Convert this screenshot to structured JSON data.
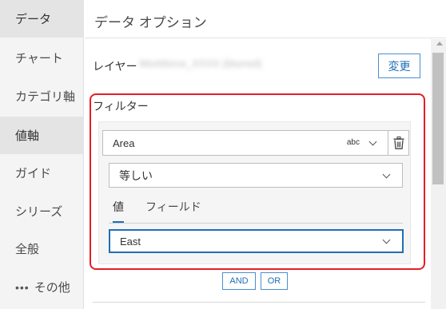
{
  "sidebar": {
    "items": [
      {
        "label": "データ",
        "active": true
      },
      {
        "label": "チャート"
      },
      {
        "label": "カテゴリ軸"
      },
      {
        "label": "値軸",
        "active": true
      },
      {
        "label": "ガイド"
      },
      {
        "label": "シリーズ"
      },
      {
        "label": "全般"
      },
      {
        "label": "その他",
        "icon": "more-horizontal-icon",
        "icon_glyph": "•••"
      }
    ]
  },
  "panel": {
    "title": "データ オプション",
    "layer_label": "レイヤー",
    "layer_value": "Workforce_XXXX (blurred)",
    "change_button": "変更"
  },
  "filter": {
    "title": "フィルター",
    "field": {
      "value": "Area",
      "type_badge": "abc"
    },
    "delete_icon": "trash-icon",
    "operator": {
      "value": "等しい"
    },
    "tabs": [
      {
        "label": "値",
        "active": true
      },
      {
        "label": "フィールド",
        "active": false
      }
    ],
    "value_select": {
      "value": "East"
    },
    "and_button": "AND",
    "or_button": "OR"
  },
  "colors": {
    "accent": "#1f6fb5",
    "highlight_frame": "#e81c24",
    "sidebar_bg": "#f4f4f4",
    "sidebar_active_bg": "#e4e4e4"
  }
}
